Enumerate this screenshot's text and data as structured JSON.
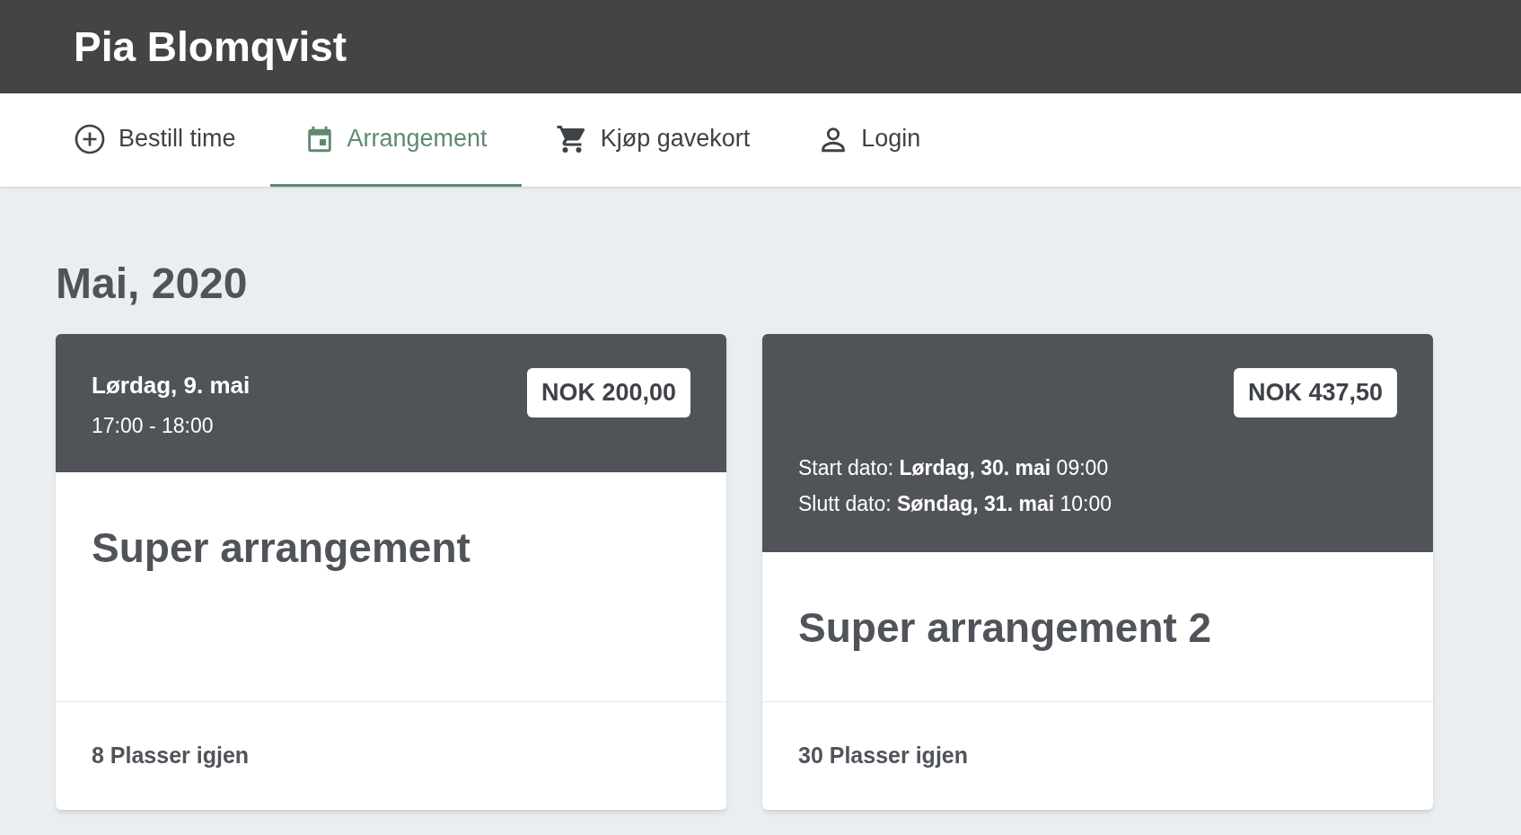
{
  "header": {
    "title": "Pia Blomqvist"
  },
  "nav": {
    "items": [
      {
        "label": "Bestill time",
        "kind": "plus",
        "selected": false
      },
      {
        "label": "Arrangement",
        "kind": "calendar",
        "selected": true
      },
      {
        "label": "Kjøp gavekort",
        "kind": "cart",
        "selected": false
      },
      {
        "label": "Login",
        "kind": "person",
        "selected": false
      }
    ]
  },
  "month": "Mai, 2020",
  "events": [
    {
      "kind": "single",
      "date": "Lørdag, 9. mai",
      "time": "17:00 - 18:00",
      "price": "NOK 200,00",
      "title": "Super arrangement",
      "spots": "8 Plasser igjen"
    },
    {
      "kind": "range",
      "price": "NOK 437,50",
      "start": "Start dato: **Lørdag, 30. mai** 09:00",
      "end": "Slutt dato: **Søndag, 31. mai** 10:00",
      "title": "Super arrangement 2",
      "spots": "30 Plasser igjen"
    }
  ]
}
